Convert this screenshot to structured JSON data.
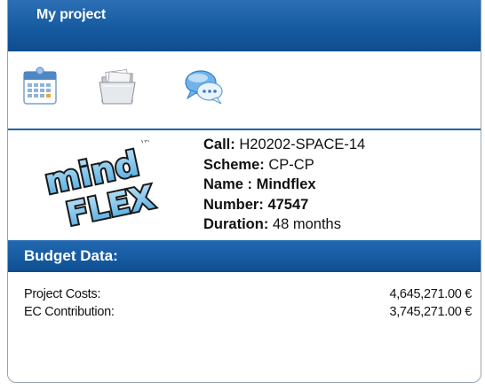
{
  "panel": {
    "title": "My project"
  },
  "toolbar": {
    "icons": [
      {
        "name": "calendar-icon"
      },
      {
        "name": "folder-icon"
      },
      {
        "name": "chat-bubbles-icon"
      }
    ]
  },
  "project": {
    "logo_text": "mind FLEX",
    "call_label": "Call:",
    "call_value": "H20202-SPACE-14",
    "scheme_label": "Scheme:",
    "scheme_value": "CP-CP",
    "name_label": "Name :",
    "name_value": "Mindflex",
    "number_label": "Number:",
    "number_value": "47547",
    "duration_label": "Duration:",
    "duration_value": "48 months"
  },
  "budget": {
    "title": "Budget Data:",
    "rows": [
      {
        "label": "Project Costs:",
        "value": "4,645,271.00 €"
      },
      {
        "label": "EC Contribution:",
        "value": "3,745,271.00 €"
      }
    ]
  },
  "colors": {
    "header_blue": "#165aa0",
    "divider_blue": "#1e63ab"
  }
}
